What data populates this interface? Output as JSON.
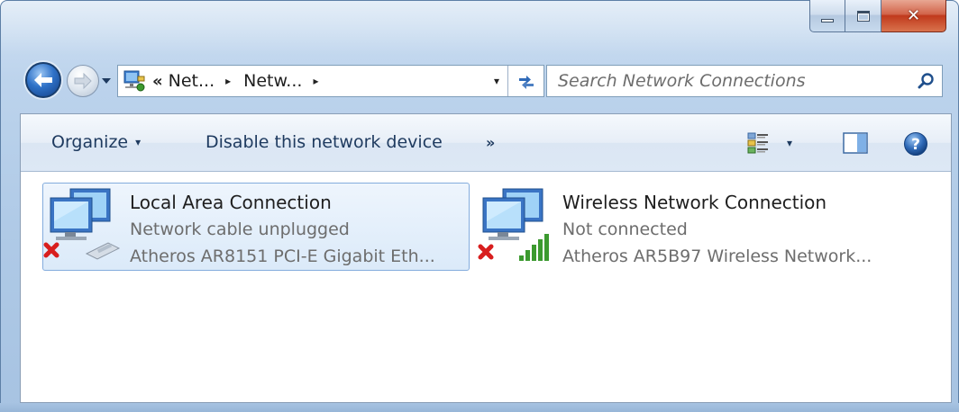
{
  "window": {
    "caption_buttons": {
      "minimize_icon": "minimize-icon",
      "maximize_icon": "maximize-icon",
      "close_icon": "close-icon"
    }
  },
  "navigation": {
    "back_icon": "back-arrow-icon",
    "forward_icon": "forward-arrow-icon",
    "address": {
      "overflow_chevron": "«",
      "crumbs": [
        "Net...",
        "Netw..."
      ],
      "crumb_arrow": "▸",
      "dropdown": "▾"
    },
    "refresh_icon": "refresh-icon",
    "search": {
      "placeholder": "Search Network Connections",
      "icon": "search-icon"
    }
  },
  "commandbar": {
    "organize_label": "Organize",
    "organize_caret": "▾",
    "disable_label": "Disable this network device",
    "more_label": "»",
    "view_caret": "▾"
  },
  "connections": [
    {
      "name": "Local Area Connection",
      "status": "Network cable unplugged",
      "device": "Atheros AR8151 PCI-E Gigabit Eth...",
      "selected": true
    },
    {
      "name": "Wireless Network Connection",
      "status": "Not connected",
      "device": "Atheros AR5B97 Wireless Network...",
      "selected": false
    }
  ],
  "colors": {
    "accent": "#2f72c8",
    "selection_border": "#84acdd",
    "error_x": "#d81e1e",
    "signal_green": "#3c9a2f"
  }
}
